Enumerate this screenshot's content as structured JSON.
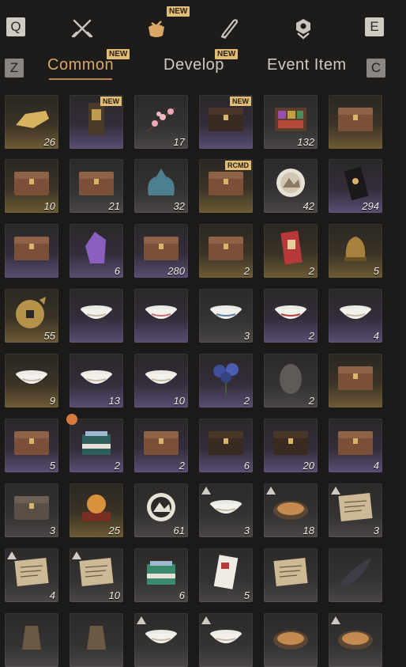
{
  "header": {
    "left_key": "Q",
    "right_key": "E",
    "icons": [
      "crossed-swords-icon",
      "pouch-icon",
      "scroll-icon",
      "badge-icon"
    ],
    "active_icon_index": 1,
    "active_icon_new": "NEW"
  },
  "tabs": {
    "left_key": "Z",
    "right_key": "C",
    "items": [
      {
        "label": "Common",
        "new": "NEW",
        "active": true
      },
      {
        "label": "Develop",
        "new": "NEW",
        "active": false
      },
      {
        "label": "Event Item",
        "new": "",
        "active": false
      }
    ]
  },
  "inventory": {
    "items": [
      {
        "icon": "gold-ingot-icon",
        "qty": "26",
        "rarity": "gold",
        "badge": ""
      },
      {
        "icon": "banner-icon",
        "qty": "",
        "rarity": "purple",
        "badge": "NEW"
      },
      {
        "icon": "plum-blossom-icon",
        "qty": "17",
        "rarity": "gray",
        "badge": ""
      },
      {
        "icon": "dark-chest-icon",
        "qty": "",
        "rarity": "purple",
        "badge": "NEW"
      },
      {
        "icon": "dye-box-icon",
        "qty": "132",
        "rarity": "gray",
        "badge": ""
      },
      {
        "icon": "ornate-chest-icon",
        "qty": "",
        "rarity": "gold",
        "badge": ""
      },
      {
        "icon": "ornate-chest-icon",
        "qty": "10",
        "rarity": "gold",
        "badge": ""
      },
      {
        "icon": "wooden-chest-icon",
        "qty": "21",
        "rarity": "gray",
        "badge": ""
      },
      {
        "icon": "cloth-bundle-icon",
        "qty": "32",
        "rarity": "gray",
        "badge": ""
      },
      {
        "icon": "ornate-chest-icon",
        "qty": "",
        "rarity": "gold",
        "badge": "RCMD"
      },
      {
        "icon": "seal-token-icon",
        "qty": "42",
        "rarity": "gray",
        "badge": ""
      },
      {
        "icon": "black-card-icon",
        "qty": "294",
        "rarity": "purple",
        "badge": ""
      },
      {
        "icon": "wooden-chest-icon",
        "qty": "",
        "rarity": "purple",
        "badge": ""
      },
      {
        "icon": "amethyst-icon",
        "qty": "6",
        "rarity": "purple",
        "badge": ""
      },
      {
        "icon": "carved-chest-icon",
        "qty": "280",
        "rarity": "purple",
        "badge": ""
      },
      {
        "icon": "outfit-chest-icon",
        "qty": "2",
        "rarity": "gold",
        "badge": ""
      },
      {
        "icon": "red-envelope-icon",
        "qty": "2",
        "rarity": "gold",
        "badge": ""
      },
      {
        "icon": "bronze-bell-icon",
        "qty": "5",
        "rarity": "gold",
        "badge": ""
      },
      {
        "icon": "ancient-coin-icon",
        "qty": "55",
        "rarity": "gold",
        "badge": ""
      },
      {
        "icon": "porcelain-bowl-icon",
        "qty": "",
        "rarity": "purple",
        "badge": ""
      },
      {
        "icon": "floral-bowl-icon",
        "qty": "",
        "rarity": "purple",
        "badge": ""
      },
      {
        "icon": "painted-bowl-icon",
        "qty": "3",
        "rarity": "gray",
        "badge": ""
      },
      {
        "icon": "rooster-bowl-icon",
        "qty": "2",
        "rarity": "purple",
        "badge": ""
      },
      {
        "icon": "white-bowl-icon",
        "qty": "4",
        "rarity": "purple",
        "badge": ""
      },
      {
        "icon": "lidded-bowl-icon",
        "qty": "9",
        "rarity": "gold",
        "badge": ""
      },
      {
        "icon": "saucer-icon",
        "qty": "13",
        "rarity": "purple",
        "badge": ""
      },
      {
        "icon": "rim-bowl-icon",
        "qty": "10",
        "rarity": "purple",
        "badge": ""
      },
      {
        "icon": "blue-flower-icon",
        "qty": "2",
        "rarity": "purple",
        "badge": ""
      },
      {
        "icon": "stone-egg-icon",
        "qty": "2",
        "rarity": "gray",
        "badge": ""
      },
      {
        "icon": "carved-chest-icon",
        "qty": "",
        "rarity": "gold",
        "badge": ""
      },
      {
        "icon": "ornate-chest-icon",
        "qty": "5",
        "rarity": "purple",
        "badge": ""
      },
      {
        "icon": "gift-box-icon",
        "qty": "2",
        "rarity": "purple",
        "badge": "",
        "timer": true
      },
      {
        "icon": "wooden-chest-icon",
        "qty": "2",
        "rarity": "purple",
        "badge": ""
      },
      {
        "icon": "dark-cabinet-icon",
        "qty": "6",
        "rarity": "purple",
        "badge": ""
      },
      {
        "icon": "dark-cabinet-icon",
        "qty": "20",
        "rarity": "purple",
        "badge": ""
      },
      {
        "icon": "ornate-chest-icon",
        "qty": "4",
        "rarity": "purple",
        "badge": ""
      },
      {
        "icon": "iron-chest-icon",
        "qty": "3",
        "rarity": "gray",
        "badge": ""
      },
      {
        "icon": "orb-pedestal-icon",
        "qty": "25",
        "rarity": "gold",
        "badge": ""
      },
      {
        "icon": "mountain-seal-icon",
        "qty": "61",
        "rarity": "gray",
        "badge": ""
      },
      {
        "icon": "stew-bowl-icon",
        "qty": "3",
        "rarity": "gray",
        "badge": "",
        "mark": true
      },
      {
        "icon": "bun-plate-icon",
        "qty": "18",
        "rarity": "gray",
        "badge": "",
        "mark": true
      },
      {
        "icon": "letter-icon",
        "qty": "3",
        "rarity": "gray",
        "badge": "",
        "mark": true
      },
      {
        "icon": "letter-icon",
        "qty": "4",
        "rarity": "gray",
        "badge": "",
        "mark": true
      },
      {
        "icon": "letter-icon",
        "qty": "10",
        "rarity": "gray",
        "badge": "",
        "mark": true
      },
      {
        "icon": "pastry-box-icon",
        "qty": "6",
        "rarity": "gray",
        "badge": ""
      },
      {
        "icon": "red-scroll-icon",
        "qty": "5",
        "rarity": "gray",
        "badge": ""
      },
      {
        "icon": "parchment-icon",
        "qty": "",
        "rarity": "gray",
        "badge": ""
      },
      {
        "icon": "horn-icon",
        "qty": "",
        "rarity": "gray",
        "badge": ""
      },
      {
        "icon": "vase-icon",
        "qty": "",
        "rarity": "gray",
        "badge": ""
      },
      {
        "icon": "pot-icon",
        "qty": "",
        "rarity": "gray",
        "badge": ""
      },
      {
        "icon": "stew-bowl-icon",
        "qty": "",
        "rarity": "gray",
        "badge": "",
        "mark": true
      },
      {
        "icon": "stew-bowl-icon",
        "qty": "",
        "rarity": "gray",
        "badge": "",
        "mark": true
      },
      {
        "icon": "bun-plate-icon",
        "qty": "",
        "rarity": "gray",
        "badge": ""
      },
      {
        "icon": "bun-plate-icon",
        "qty": "",
        "rarity": "gray",
        "badge": "",
        "mark": true
      }
    ]
  },
  "colors": {
    "accent": "#d9a865",
    "new_tag": "#e1bd75"
  }
}
